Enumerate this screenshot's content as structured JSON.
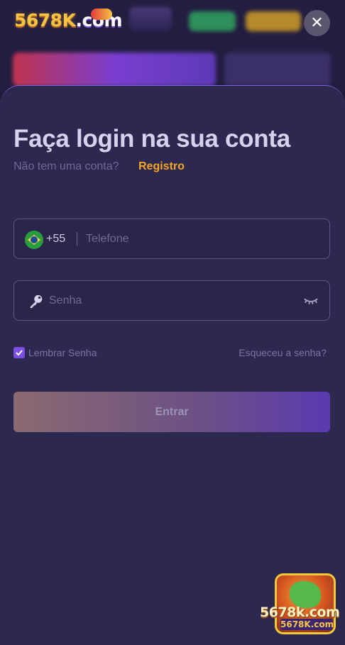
{
  "header": {
    "logo_text": "5678K",
    "logo_suffix": ".com",
    "close_glyph": "✕"
  },
  "login": {
    "title": "Faça login na sua conta",
    "no_account_text": "Não tem uma conta?",
    "register_label": "Registro",
    "phone": {
      "country_code": "+55",
      "placeholder": "Telefone",
      "value": ""
    },
    "password": {
      "placeholder": "Senha",
      "value": ""
    },
    "remember_label": "Lembrar Senha",
    "remember_checked": true,
    "forgot_label": "Esqueceu a senha?",
    "submit_label": "Entrar"
  },
  "promo": {
    "text": "5678k.com",
    "sub_text": "5678K.com"
  },
  "colors": {
    "sheet_bg": "#2d2850",
    "accent_orange": "#f5a623",
    "checkbox_purple": "#7b4fe0",
    "title_color": "#d6d2ee"
  },
  "icons": {
    "close": "close-icon",
    "flag": "brazil-flag-icon",
    "key": "key-icon",
    "eye": "eye-hidden-icon",
    "check": "check-icon"
  }
}
